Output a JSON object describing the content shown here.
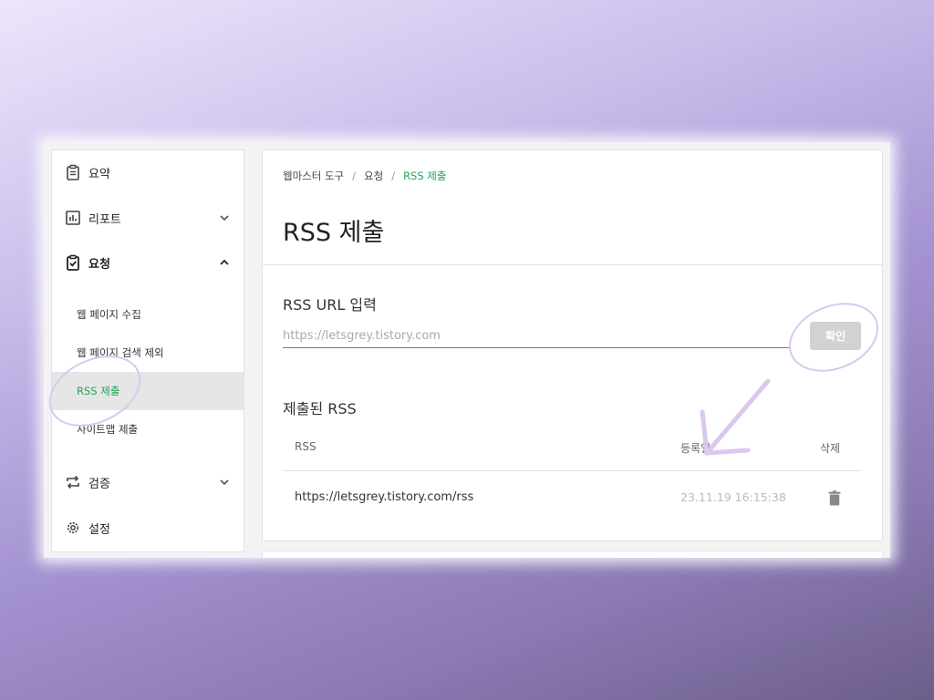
{
  "sidebar": {
    "summary": "요약",
    "report": "리포트",
    "request": "요청",
    "sub_items": [
      "웹 페이지 수집",
      "웹 페이지 검색 제외",
      "RSS 제출",
      "사이트맵 제출"
    ],
    "verify": "검증",
    "settings": "설정"
  },
  "breadcrumb": [
    "웹마스터 도구",
    "요청",
    "RSS 제출"
  ],
  "page_title": "RSS 제출",
  "url_section": {
    "title": "RSS URL 입력",
    "placeholder": "https://letsgrey.tistory.com",
    "confirm_label": "확인"
  },
  "submitted": {
    "title": "제출된 RSS",
    "headers": [
      "RSS",
      "등록일",
      "삭제"
    ],
    "rows": [
      {
        "url": "https://letsgrey.tistory.com/rss",
        "date": "23.11.19 16:15:38"
      }
    ]
  },
  "colors": {
    "accent_green": "#1ea65a",
    "input_underline": "#e04b4b",
    "annotation": "#dcc7f0"
  },
  "icons": [
    "clipboard-icon",
    "bar-chart-icon",
    "clipboard-check-icon",
    "swap-arrows-icon",
    "gear-icon",
    "chevron-down-icon",
    "chevron-up-icon",
    "trash-icon"
  ]
}
